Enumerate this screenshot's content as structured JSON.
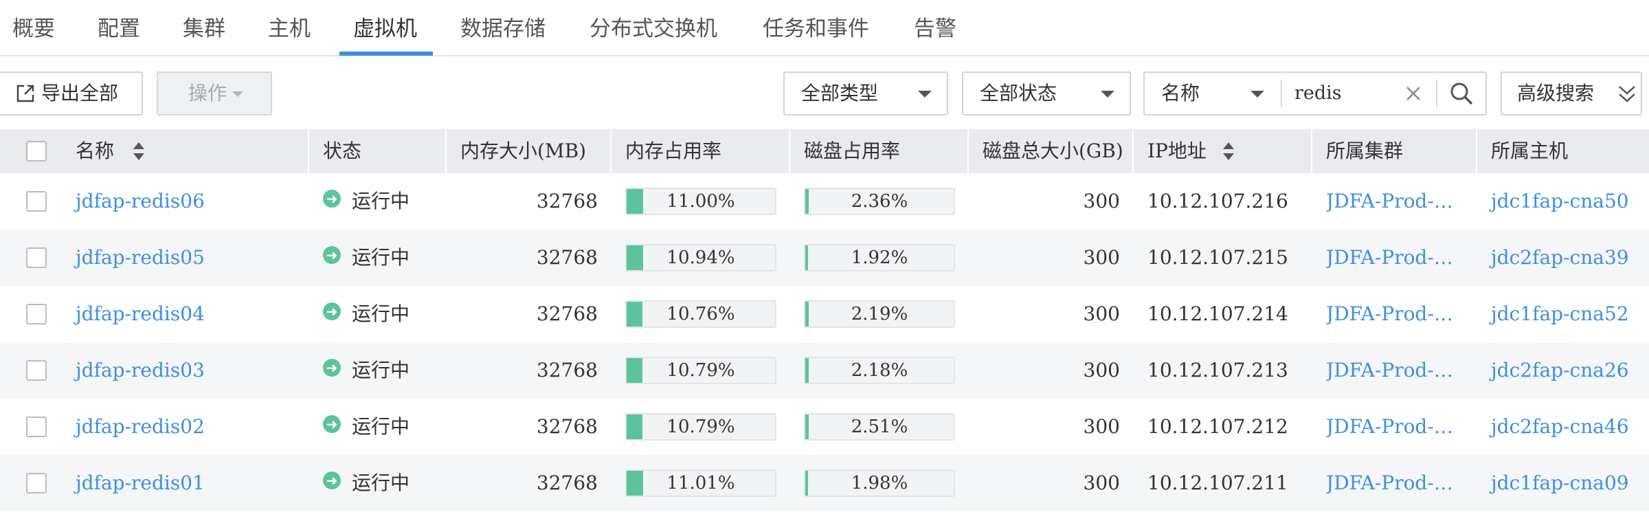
{
  "nav": {
    "tabs": [
      {
        "label": "概要"
      },
      {
        "label": "配置"
      },
      {
        "label": "集群"
      },
      {
        "label": "主机"
      },
      {
        "label": "虚拟机",
        "active": true
      },
      {
        "label": "数据存储"
      },
      {
        "label": "分布式交换机"
      },
      {
        "label": "任务和事件"
      },
      {
        "label": "告警"
      }
    ]
  },
  "toolbar": {
    "export_all_label": "导出全部",
    "operation_label": "操作",
    "type_filter": "全部类型",
    "status_filter": "全部状态",
    "search_field": "名称",
    "search_value": "redis",
    "advanced_search_label": "高级搜索"
  },
  "table": {
    "columns": [
      "名称",
      "状态",
      "内存大小(MB)",
      "内存占用率",
      "磁盘占用率",
      "磁盘总大小(GB)",
      "IP地址",
      "所属集群",
      "所属主机"
    ],
    "rows": [
      {
        "name": "jdfap-redis06",
        "status": "运行中",
        "memory_mb": "32768",
        "mem_usage": "11.00%",
        "mem_usage_value": 11.0,
        "disk_usage": "2.36%",
        "disk_usage_value": 2.36,
        "disk_total_gb": "300",
        "ip": "10.12.107.216",
        "cluster": "JDFA-Prod-Cl…",
        "host": "jdc1fap-cna50"
      },
      {
        "name": "jdfap-redis05",
        "status": "运行中",
        "memory_mb": "32768",
        "mem_usage": "10.94%",
        "mem_usage_value": 10.94,
        "disk_usage": "1.92%",
        "disk_usage_value": 1.92,
        "disk_total_gb": "300",
        "ip": "10.12.107.215",
        "cluster": "JDFA-Prod-Cl…",
        "host": "jdc2fap-cna39"
      },
      {
        "name": "jdfap-redis04",
        "status": "运行中",
        "memory_mb": "32768",
        "mem_usage": "10.76%",
        "mem_usage_value": 10.76,
        "disk_usage": "2.19%",
        "disk_usage_value": 2.19,
        "disk_total_gb": "300",
        "ip": "10.12.107.214",
        "cluster": "JDFA-Prod-Cl…",
        "host": "jdc1fap-cna52"
      },
      {
        "name": "jdfap-redis03",
        "status": "运行中",
        "memory_mb": "32768",
        "mem_usage": "10.79%",
        "mem_usage_value": 10.79,
        "disk_usage": "2.18%",
        "disk_usage_value": 2.18,
        "disk_total_gb": "300",
        "ip": "10.12.107.213",
        "cluster": "JDFA-Prod-Cl…",
        "host": "jdc2fap-cna26"
      },
      {
        "name": "jdfap-redis02",
        "status": "运行中",
        "memory_mb": "32768",
        "mem_usage": "10.79%",
        "mem_usage_value": 10.79,
        "disk_usage": "2.51%",
        "disk_usage_value": 2.51,
        "disk_total_gb": "300",
        "ip": "10.12.107.212",
        "cluster": "JDFA-Prod-Cl…",
        "host": "jdc2fap-cna46"
      },
      {
        "name": "jdfap-redis01",
        "status": "运行中",
        "memory_mb": "32768",
        "mem_usage": "11.01%",
        "mem_usage_value": 11.01,
        "disk_usage": "1.98%",
        "disk_usage_value": 1.98,
        "disk_total_gb": "300",
        "ip": "10.12.107.211",
        "cluster": "JDFA-Prod-Cl…",
        "host": "jdc1fap-cna09"
      }
    ]
  },
  "colors": {
    "accent": "#3d8fe3",
    "status_running": "#5bc49a",
    "usage_bar": "#5bc49a"
  }
}
